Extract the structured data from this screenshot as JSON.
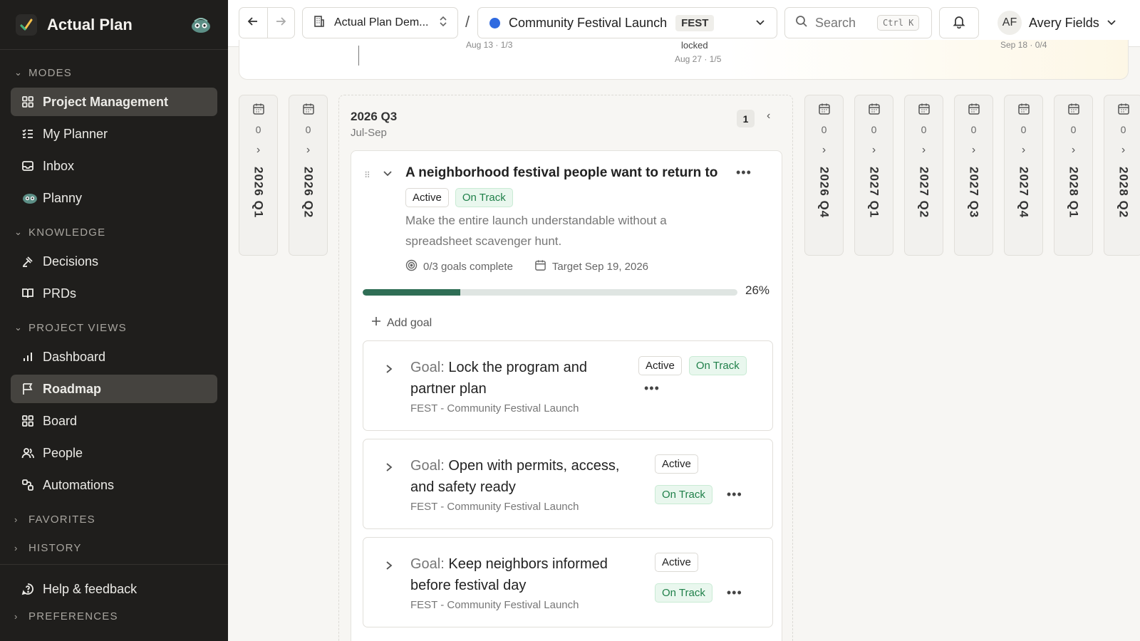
{
  "app": {
    "title": "Actual Plan"
  },
  "sidebar": {
    "sections": {
      "modes": "MODES",
      "knowledge": "KNOWLEDGE",
      "project_views": "PROJECT VIEWS",
      "favorites": "FAVORITES",
      "history": "HISTORY",
      "preferences": "PREFERENCES"
    },
    "modes": [
      {
        "label": "Project Management",
        "icon": "grid-icon",
        "active": true
      },
      {
        "label": "My Planner",
        "icon": "checklist-icon"
      },
      {
        "label": "Inbox",
        "icon": "inbox-icon"
      },
      {
        "label": "Planny",
        "icon": "mascot-icon"
      }
    ],
    "knowledge": [
      {
        "label": "Decisions",
        "icon": "gavel-icon"
      },
      {
        "label": "PRDs",
        "icon": "book-icon"
      }
    ],
    "project_views": [
      {
        "label": "Dashboard",
        "icon": "bar-chart-icon"
      },
      {
        "label": "Roadmap",
        "icon": "flag-icon",
        "active": true
      },
      {
        "label": "Board",
        "icon": "grid-icon"
      },
      {
        "label": "People",
        "icon": "people-icon"
      },
      {
        "label": "Automations",
        "icon": "automation-icon"
      }
    ],
    "help": "Help & feedback"
  },
  "topbar": {
    "workspace": "Actual Plan Dem...",
    "separator": "/",
    "project": "Community Festival Launch",
    "project_key": "FEST",
    "project_color": "#2f6ae0",
    "search_placeholder": "Search",
    "search_shortcut": "Ctrl K",
    "user_initials": "AF",
    "user_name": "Avery Fields"
  },
  "timeline_header": {
    "left_date": "Aug 13 · 1/3",
    "mid_label": "locked",
    "mid_date": "Aug 27 · 1/5",
    "right_date": "Sep 18 · 0/4"
  },
  "columns_left": [
    {
      "label": "2026 Q1",
      "count": "0"
    },
    {
      "label": "2026 Q2",
      "count": "0"
    }
  ],
  "columns_right": [
    {
      "label": "2026 Q4",
      "count": "0"
    },
    {
      "label": "2027 Q1",
      "count": "0"
    },
    {
      "label": "2027 Q2",
      "count": "0"
    },
    {
      "label": "2027 Q3",
      "count": "0"
    },
    {
      "label": "2027 Q4",
      "count": "0"
    },
    {
      "label": "2028 Q1",
      "count": "0"
    },
    {
      "label": "2028 Q2",
      "count": "0"
    }
  ],
  "quarter": {
    "title": "2026 Q3",
    "range": "Jul-Sep",
    "count": "1",
    "outcome": {
      "title": "A neighborhood festival people want to return to",
      "status": "Active",
      "health": "On Track",
      "description": "Make the entire launch understandable without a spreadsheet scavenger hunt.",
      "goals_complete": "0/3 goals complete",
      "target": "Target Sep 19, 2026",
      "progress_percent": 26,
      "progress_label": "26%",
      "add_goal": "Add goal",
      "goals": [
        {
          "prefix": "Goal:",
          "title": "Lock the program and partner plan",
          "subtitle": "FEST - Community Festival Launch",
          "status": "Active",
          "health": "On Track"
        },
        {
          "prefix": "Goal:",
          "title": "Open with permits, access, and safety ready",
          "subtitle": "FEST - Community Festival Launch",
          "status": "Active",
          "health": "On Track"
        },
        {
          "prefix": "Goal:",
          "title": "Keep neighbors informed before festival day",
          "subtitle": "FEST - Community Festival Launch",
          "status": "Active",
          "health": "On Track"
        }
      ]
    }
  }
}
